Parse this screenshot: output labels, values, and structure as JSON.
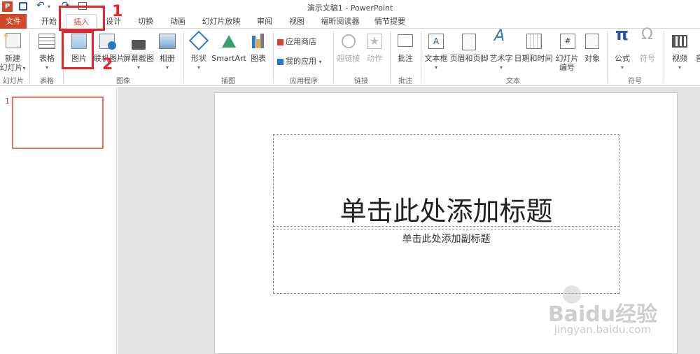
{
  "title": "演示文稿1 - PowerPoint",
  "colors": {
    "accent": "#d24726",
    "annotation": "#e8232a",
    "blue": "#2b579a"
  },
  "tabs": [
    "文件",
    "开始",
    "插入",
    "设计",
    "切换",
    "动画",
    "幻灯片放映",
    "审阅",
    "视图",
    "福昕阅读器",
    "情节提要"
  ],
  "ribbon": {
    "new_slide": "新建",
    "new_slide2": "幻灯片",
    "table": "表格",
    "picture": "图片",
    "online_picture": "联机图片",
    "screenshot": "屏幕截图",
    "album": "相册",
    "shapes": "形状",
    "smartart": "SmartArt",
    "chart": "图表",
    "store": "应用商店",
    "my_apps": "我的应用",
    "hyperlink": "超链接",
    "action": "动作",
    "comment": "批注",
    "textbox": "文本框",
    "header_footer": "页眉和页脚",
    "wordart": "艺术字",
    "datetime": "日期和时间",
    "slide_num": "幻灯片",
    "slide_num2": "编号",
    "object": "对象",
    "equation": "公式",
    "symbol": "符号",
    "video": "视频",
    "audio": "音"
  },
  "groups": {
    "slides": "幻灯片",
    "tables": "表格",
    "images": "图像",
    "illustrations": "插图",
    "apps": "应用程序",
    "links": "链接",
    "comments": "批注",
    "text": "文本",
    "symbols": "符号"
  },
  "thumbnail_number": "1",
  "slide": {
    "title_placeholder": "单击此处添加标题",
    "subtitle_placeholder": "单击此处添加副标题"
  },
  "annotations": {
    "one": "1",
    "two": "2"
  },
  "watermark": {
    "brand": "Baidu经验",
    "url": "jingyan.baidu.com"
  }
}
